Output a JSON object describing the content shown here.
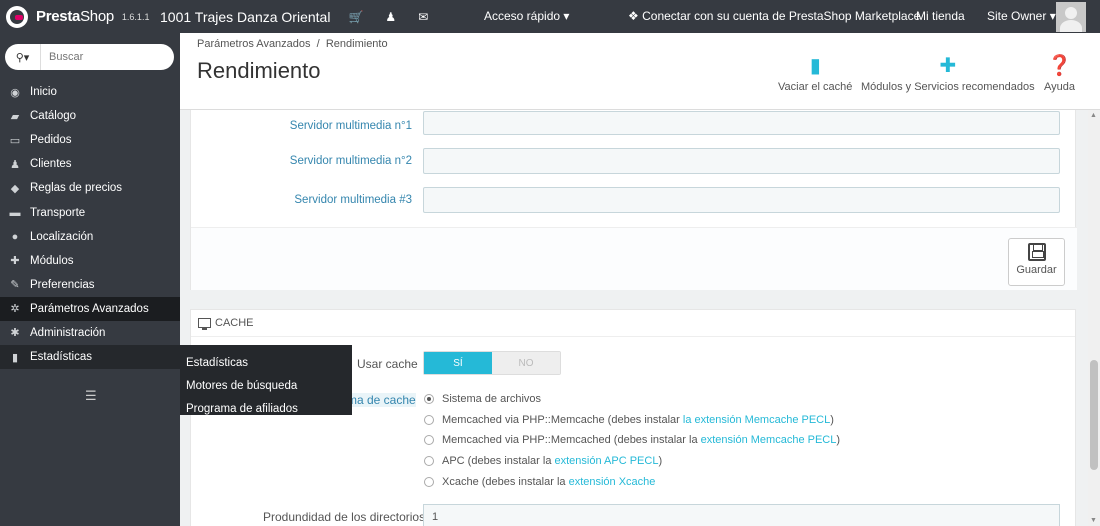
{
  "topbar": {
    "brand_part1": "Presta",
    "brand_part2": "Shop",
    "version": "1.6.1.1",
    "shop_name": "1001 Trajes Danza Oriental",
    "quick_access": "Acceso rápido",
    "connect": "Conectar con su cuenta de PrestaShop Marketplace",
    "my_store": "Mi tienda",
    "owner": "Site Owner"
  },
  "sidebar": {
    "search_placeholder": "Buscar",
    "items": [
      {
        "label": "Inicio",
        "icon": "dashboard-icon",
        "glyph": "◉"
      },
      {
        "label": "Catálogo",
        "icon": "book-icon",
        "glyph": "▰"
      },
      {
        "label": "Pedidos",
        "icon": "credit-card-icon",
        "glyph": "▭"
      },
      {
        "label": "Clientes",
        "icon": "users-icon",
        "glyph": "♟"
      },
      {
        "label": "Reglas de precios",
        "icon": "tag-icon",
        "glyph": "◆"
      },
      {
        "label": "Transporte",
        "icon": "truck-icon",
        "glyph": "▬"
      },
      {
        "label": "Localización",
        "icon": "globe-icon",
        "glyph": "●"
      },
      {
        "label": "Módulos",
        "icon": "puzzle-icon",
        "glyph": "✚"
      },
      {
        "label": "Preferencias",
        "icon": "wrench-icon",
        "glyph": "✎"
      },
      {
        "label": "Parámetros Avanzados",
        "icon": "cogs-icon",
        "glyph": "✲"
      },
      {
        "label": "Administración",
        "icon": "cog-icon",
        "glyph": "✱"
      },
      {
        "label": "Estadísticas",
        "icon": "bar-chart-icon",
        "glyph": "▮"
      }
    ],
    "submenu": [
      "Estadísticas",
      "Motores de búsqueda",
      "Programa de afiliados"
    ]
  },
  "header": {
    "breadcrumb_parent": "Parámetros Avanzados",
    "breadcrumb_sep": "/",
    "breadcrumb_current": "Rendimiento",
    "title": "Rendimiento",
    "toolbar": {
      "clear_cache": "Vaciar el caché",
      "modules": "Módulos y Servicios recomendados",
      "help": "Ayuda"
    }
  },
  "media_panel": {
    "servers": [
      {
        "label": "Servidor multimedia n°1",
        "value": ""
      },
      {
        "label": "Servidor multimedia n°2",
        "value": ""
      },
      {
        "label": "Servidor multimedia #3",
        "value": ""
      }
    ],
    "save_label": "Guardar"
  },
  "cache_panel": {
    "heading": "CACHE",
    "use_cache_label": "Usar cache",
    "yes": "SÍ",
    "no": "NO",
    "system_label": "ma de cache",
    "options": [
      {
        "text": "Sistema de archivos",
        "link": "",
        "suffix": "",
        "checked": true
      },
      {
        "text": "Memcached via PHP::Memcache (debes instalar ",
        "link": "la extensión Memcache PECL",
        "suffix": ")",
        "checked": false
      },
      {
        "text": "Memcached via PHP::Memcached (debes instalar la ",
        "link": "extensión Memcache PECL",
        "suffix": ")",
        "checked": false
      },
      {
        "text": "APC (debes instalar la ",
        "link": "extensión APC PECL",
        "suffix": ")",
        "checked": false
      },
      {
        "text": "Xcache (debes instalar la ",
        "link": "extensión Xcache",
        "suffix": "",
        "checked": false
      }
    ],
    "depth_label": "Produndidad de los directorios",
    "depth_value": "1"
  },
  "colors": {
    "accent": "#25b9d7",
    "topbar": "#363a41",
    "label_blue": "#3586ae"
  }
}
